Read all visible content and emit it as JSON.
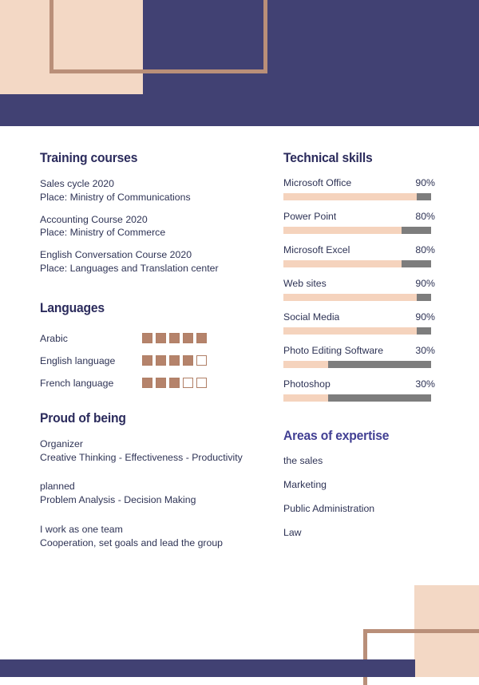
{
  "theme": {
    "navy": "#414173",
    "peach": "#f3d8c5",
    "brown": "#b98f79",
    "gray": "#7d7d7d",
    "heading_navy": "#2b2b5c",
    "heading_accent": "#413f93",
    "body_text": "#2e3355"
  },
  "left_column": {
    "training": {
      "title": "Training courses",
      "entries": [
        {
          "line1": "Sales cycle 2020",
          "line2": "Place: Ministry of Communications"
        },
        {
          "line1": "Accounting Course 2020",
          "line2": "Place: Ministry of Commerce"
        },
        {
          "line1": "English Conversation Course 2020",
          "line2": "Place: Languages and Translation center"
        }
      ]
    },
    "languages": {
      "title": "Languages",
      "max": 5,
      "items": [
        {
          "name": "Arabic",
          "level": 5
        },
        {
          "name": "English language",
          "level": 4
        },
        {
          "name": "French language",
          "level": 3
        }
      ]
    },
    "proud": {
      "title": "Proud of being",
      "groups": [
        {
          "line1": "Organizer",
          "line2": "Creative Thinking - Effectiveness - Productivity"
        },
        {
          "line1": "planned",
          "line2": "Problem Analysis - Decision Making"
        },
        {
          "line1": "I work as one team",
          "line2": "Cooperation, set goals and lead the group"
        }
      ]
    }
  },
  "right_column": {
    "technical": {
      "title": "Technical skills",
      "skills": [
        {
          "name": "Microsoft Office",
          "percent_label": "90%",
          "percent": 90
        },
        {
          "name": "Power Point",
          "percent_label": "80%",
          "percent": 80
        },
        {
          "name": "Microsoft Excel",
          "percent_label": "80%",
          "percent": 80
        },
        {
          "name": "Web sites",
          "percent_label": "90%",
          "percent": 90
        },
        {
          "name": "Social Media",
          "percent_label": "90%",
          "percent": 90
        },
        {
          "name": "Photo Editing Software",
          "percent_label": "30%",
          "percent": 30
        },
        {
          "name": "Photoshop",
          "percent_label": "30%",
          "percent": 30
        }
      ]
    },
    "expertise": {
      "title": "Areas of expertise",
      "items": [
        "the sales",
        "Marketing",
        "Public Administration",
        "Law"
      ]
    }
  }
}
